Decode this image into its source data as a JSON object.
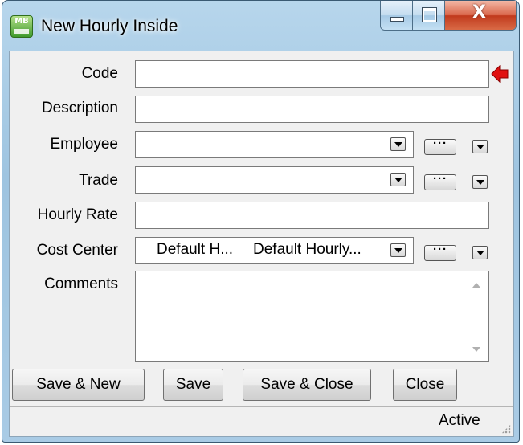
{
  "window": {
    "title": "New Hourly Inside",
    "app_icon_text": "MB",
    "controls": [
      "minimize-icon",
      "maximize-icon",
      "close-icon"
    ]
  },
  "form": {
    "fields": {
      "code": {
        "label": "Code",
        "value": "",
        "required": true
      },
      "description": {
        "label": "Description",
        "value": ""
      },
      "employee": {
        "label": "Employee",
        "value": ""
      },
      "trade": {
        "label": "Trade",
        "value": ""
      },
      "hourly_rate": {
        "label": "Hourly Rate",
        "value": ""
      },
      "cost_center": {
        "label": "Cost Center",
        "code": "Default H...",
        "name": "Default Hourly..."
      },
      "comments": {
        "label": "Comments",
        "value": ""
      }
    },
    "ellipsis_label": "···"
  },
  "buttons": {
    "save_new": {
      "pre": "Save & ",
      "key": "N",
      "post": "ew"
    },
    "save": {
      "pre": "",
      "key": "S",
      "post": "ave"
    },
    "save_close": {
      "pre": "Save & C",
      "key": "l",
      "post": "ose"
    },
    "close": {
      "pre": "Clos",
      "key": "e",
      "post": ""
    }
  },
  "status": {
    "text": "Active"
  },
  "colors": {
    "required_arrow": "#e01010",
    "titlebar": "#a9cbe5"
  }
}
